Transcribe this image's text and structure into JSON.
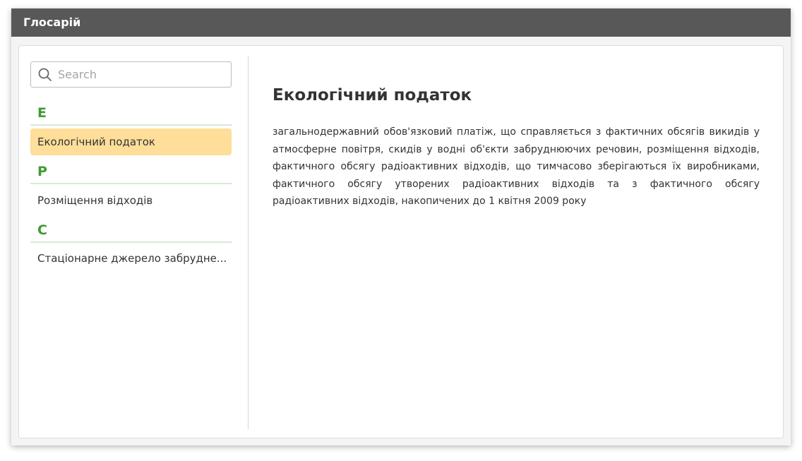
{
  "window": {
    "title": "Глосарій"
  },
  "sidebar": {
    "search": {
      "placeholder": "Search",
      "value": "",
      "icon": "search-icon"
    },
    "groups": [
      {
        "letter": "Е",
        "items": [
          {
            "label": "Екологічний податок",
            "selected": true
          }
        ]
      },
      {
        "letter": "Р",
        "items": [
          {
            "label": "Розміщення відходів",
            "selected": false
          }
        ]
      },
      {
        "letter": "С",
        "items": [
          {
            "label": "Стаціонарне джерело забрудне...",
            "selected": false
          }
        ]
      }
    ]
  },
  "content": {
    "title": "Екологічний податок",
    "definition": "загальнодержавний обов'язковий платіж, що справляється з фактичних обсягів викидів у атмосферне повітря, скидів у водні об'єкти забруднюючих речовин, розміщення відходів, фактичного обсягу радіоактивних відходів, що тимчасово зберігаються їх виробниками, фактичного обсягу утворених радіоактивних відходів та з фактичного обсягу радіоактивних відходів, накопичених до 1 квітня 2009 року"
  },
  "colors": {
    "titlebar": "#585858",
    "letter": "#3f9a32",
    "selected_item": "#fede98"
  }
}
